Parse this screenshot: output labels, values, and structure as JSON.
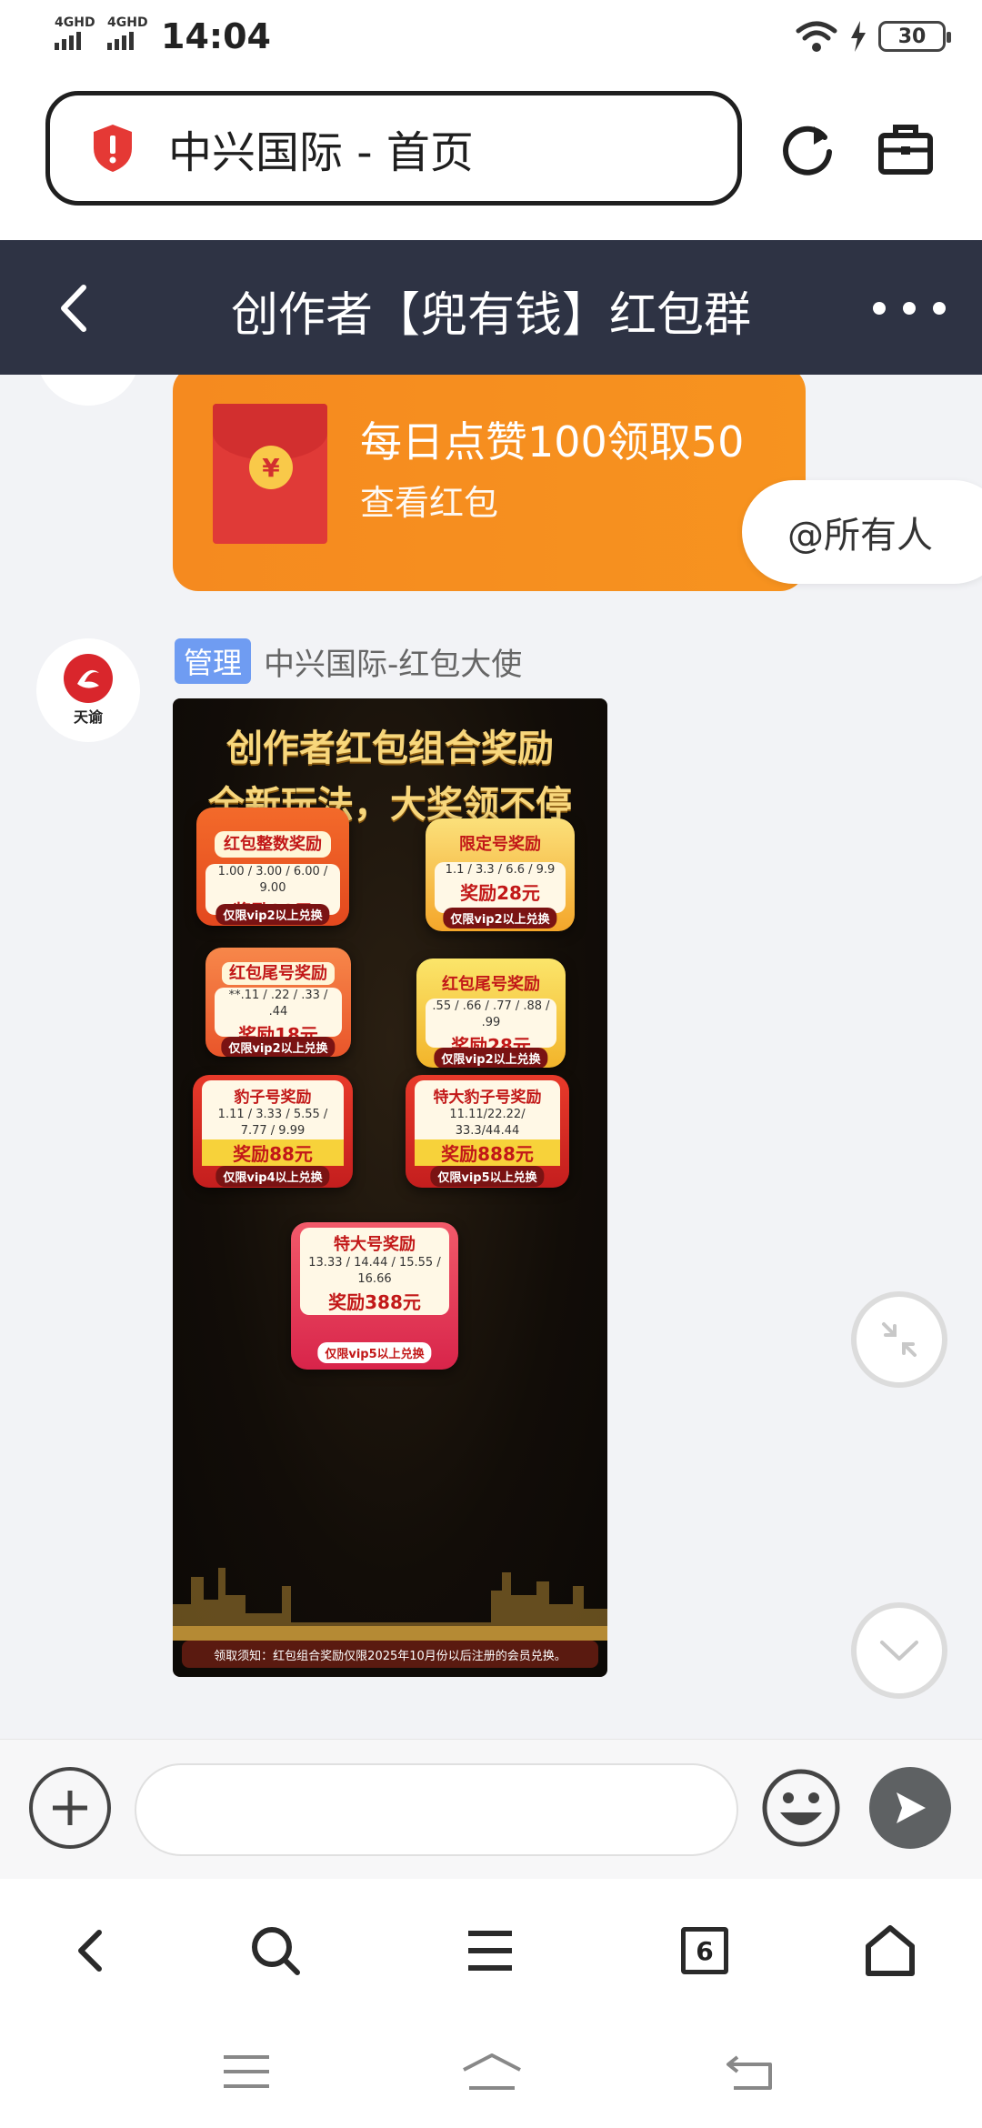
{
  "status_bar": {
    "network_1": "4GHD",
    "network_2": "4GHD",
    "time": "14:04",
    "battery": "30"
  },
  "browser": {
    "address_text": "中兴国际 - 首页",
    "tab_count": "6"
  },
  "chat": {
    "title": "创作者【兜有钱】红包群",
    "red_packet": {
      "title": "每日点赞100领取50",
      "subtitle": "查看红包",
      "coin_symbol": "¥"
    },
    "mention_all": "@所有人",
    "avatar_name": "天谕",
    "sender": {
      "badge": "管理",
      "name": "中兴国际-红包大使"
    },
    "poster": {
      "headline_1": "创作者红包组合奖励",
      "headline_2": "全新玩法，大奖领不停",
      "cards": [
        {
          "title": "红包整数奖励",
          "range": "1.00 / 3.00 / 6.00 / 9.00",
          "reward": "奖励28元",
          "requirement": "仅限vip2以上兑换"
        },
        {
          "title": "限定号奖励",
          "range": "1.1 / 3.3 / 6.6 / 9.9",
          "reward": "奖励28元",
          "requirement": "仅限vip2以上兑换"
        },
        {
          "title": "红包尾号奖励",
          "range": "**.11 / .22 / .33 / .44",
          "reward": "奖励18元",
          "requirement": "仅限vip2以上兑换"
        },
        {
          "title": "红包尾号奖励",
          "range": ".55 / .66 / .77 / .88 / .99",
          "reward": "奖励28元",
          "requirement": "仅限vip2以上兑换"
        },
        {
          "title": "豹子号奖励",
          "range": "1.11 / 3.33 / 5.55 / 7.77 / 9.99",
          "reward": "奖励88元",
          "requirement": "仅限vip4以上兑换"
        },
        {
          "title": "特大豹子号奖励",
          "range": "11.11/22.22/ 33.3/44.44",
          "reward": "奖励888元",
          "requirement": "仅限vip5以上兑换"
        },
        {
          "title": "特大号奖励",
          "range": "13.33 / 14.44 / 15.55 / 16.66",
          "reward": "奖励388元",
          "requirement": "仅限vip5以上兑换"
        }
      ],
      "note": "领取须知：红包组合奖励仅限2025年10月份以后注册的会员兑换。"
    }
  },
  "colors": {
    "header_bg": "#2e3344",
    "red_packet_orange": "#f7931f",
    "admin_badge": "#6f9cf2",
    "chat_bg": "#f2f3f6"
  }
}
